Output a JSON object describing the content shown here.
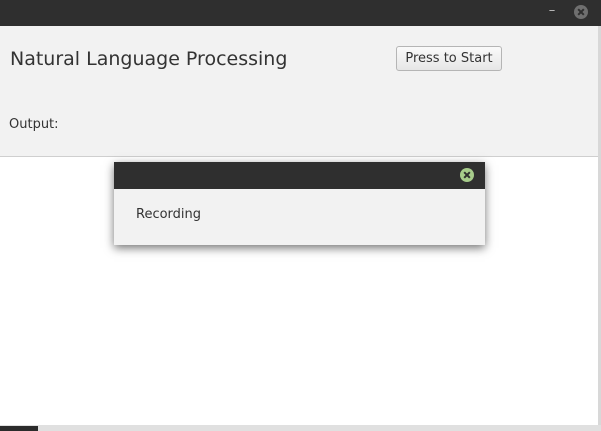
{
  "window": {
    "minimize_glyph": "–"
  },
  "app": {
    "title": "Natural Language Processing",
    "start_button_label": "Press to Start",
    "output_label": "Output:"
  },
  "dialog": {
    "message": "Recording"
  },
  "icons": {
    "window_close": "close-icon",
    "window_minimize": "minimize-icon",
    "dialog_close": "close-icon"
  },
  "colors": {
    "titlebar": "#2f2f2f",
    "panel": "#f2f2f2",
    "dialog_close_accent": "#a7cc8b"
  }
}
